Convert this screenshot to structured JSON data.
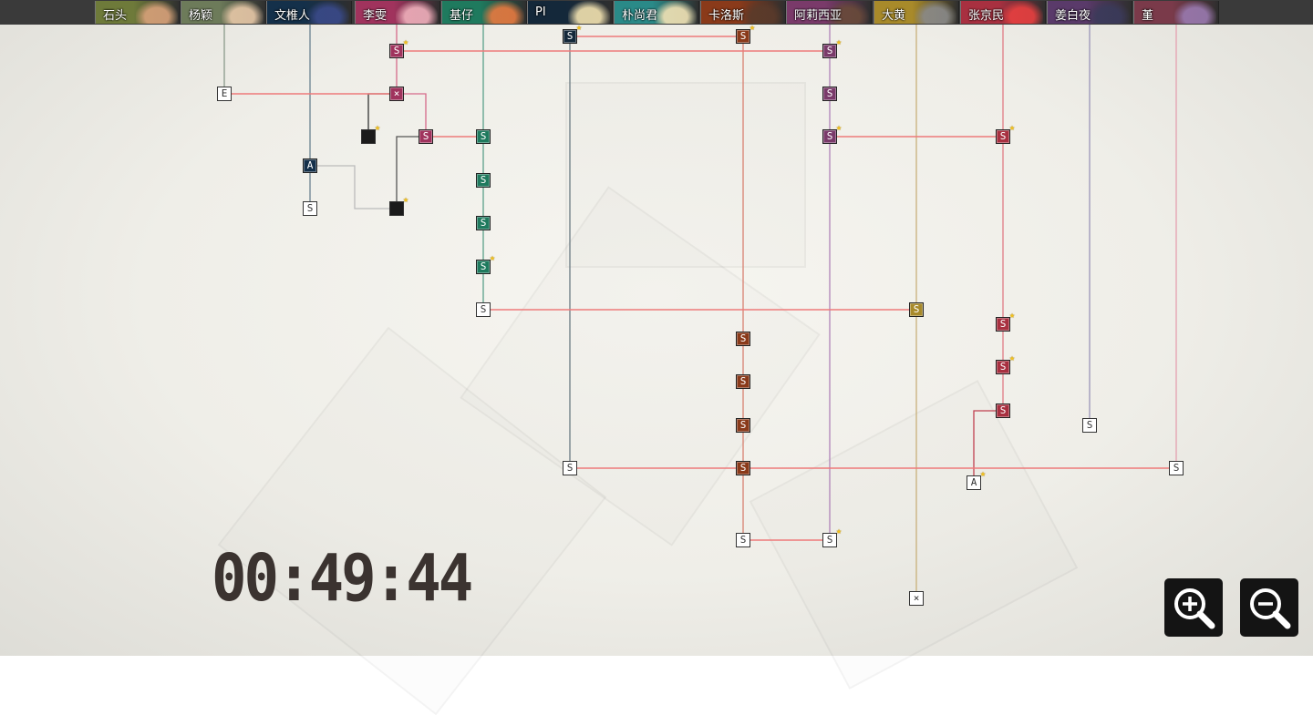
{
  "characters": [
    {
      "name": "石头",
      "color": "#6e7a3a",
      "face": "#d9a27a"
    },
    {
      "name": "杨颖",
      "color": "#6d7b5a",
      "face": "#e8c9a8"
    },
    {
      "name": "文椎人",
      "color": "#14304a",
      "face": "#3a4a8a"
    },
    {
      "name": "李雯",
      "color": "#a0335d",
      "face": "#f0b0bc"
    },
    {
      "name": "基仔",
      "color": "#1f7a5e",
      "face": "#e87a40"
    },
    {
      "name": "PI",
      "color": "#14283a",
      "face": "#f2e2b0"
    },
    {
      "name": "朴尚君",
      "color": "#2a8a88",
      "face": "#f3e4b6"
    },
    {
      "name": "卡洛斯",
      "color": "#8a3a1a",
      "face": "#5a3a2a"
    },
    {
      "name": "阿莉西亚",
      "color": "#7a3a6a",
      "face": "#6a4a3a"
    },
    {
      "name": "大黄",
      "color": "#a88a2a",
      "face": "#8a8a8a"
    },
    {
      "name": "张京民",
      "color": "#a83040",
      "face": "#e84040"
    },
    {
      "name": "姜白夜",
      "color": "#5a3a6a",
      "face": "#3a3a5a"
    },
    {
      "name": "堇",
      "color": "#7a3a4a",
      "face": "#9a7ab0"
    }
  ],
  "nodes": [
    {
      "label": "E",
      "style": "plain"
    },
    {
      "label": "S",
      "style": "colored",
      "color": "#a0335d",
      "starred": true
    },
    {
      "label": "×",
      "style": "colored",
      "color": "#a0335d"
    },
    {
      "label": "",
      "style": "locked",
      "starred": true
    },
    {
      "label": "S",
      "style": "colored",
      "color": "#a0335d"
    },
    {
      "label": "",
      "style": "locked",
      "starred": true
    },
    {
      "label": "A",
      "style": "colored",
      "color": "#14304a"
    },
    {
      "label": "S",
      "style": "plain"
    },
    {
      "label": "S",
      "style": "colored",
      "color": "#1f7a5e"
    },
    {
      "label": "S",
      "style": "colored",
      "color": "#1f7a5e"
    },
    {
      "label": "S",
      "style": "colored",
      "color": "#1f7a5e"
    },
    {
      "label": "S",
      "style": "colored",
      "color": "#1f7a5e",
      "starred": true
    },
    {
      "label": "S",
      "style": "plain"
    },
    {
      "label": "S",
      "style": "colored",
      "color": "#14283a",
      "starred": true
    },
    {
      "label": "S",
      "style": "plain"
    },
    {
      "label": "S",
      "style": "colored",
      "color": "#8a3a1a",
      "starred": true
    },
    {
      "label": "S",
      "style": "colored",
      "color": "#8a3a1a"
    },
    {
      "label": "S",
      "style": "colored",
      "color": "#8a3a1a"
    },
    {
      "label": "S",
      "style": "colored",
      "color": "#8a3a1a"
    },
    {
      "label": "S",
      "style": "colored",
      "color": "#8a3a1a"
    },
    {
      "label": "S",
      "style": "plain"
    },
    {
      "label": "S",
      "style": "colored",
      "color": "#7a3a6a",
      "starred": true
    },
    {
      "label": "S",
      "style": "colored",
      "color": "#7a3a6a"
    },
    {
      "label": "S",
      "style": "colored",
      "color": "#7a3a6a",
      "starred": true
    },
    {
      "label": "S",
      "style": "plain",
      "starred": true
    },
    {
      "label": "S",
      "style": "colored",
      "color": "#a88a2a"
    },
    {
      "label": "×",
      "style": "plain"
    },
    {
      "label": "S",
      "style": "colored",
      "color": "#a83040",
      "starred": true
    },
    {
      "label": "S",
      "style": "colored",
      "color": "#a83040",
      "starred": true
    },
    {
      "label": "S",
      "style": "colored",
      "color": "#a83040",
      "starred": true
    },
    {
      "label": "S",
      "style": "colored",
      "color": "#a83040"
    },
    {
      "label": "A",
      "style": "plain",
      "starred": true
    },
    {
      "label": "S",
      "style": "plain"
    },
    {
      "label": "S",
      "style": "plain"
    }
  ],
  "timer": "00:49:44",
  "controls": {
    "zoom_in_icon": "zoom-in-magnifier",
    "zoom_out_icon": "zoom-out-magnifier"
  },
  "colors": {
    "link_red": "#ee7a7a",
    "background": "#f3f2ec",
    "star": "#f4c21c"
  }
}
